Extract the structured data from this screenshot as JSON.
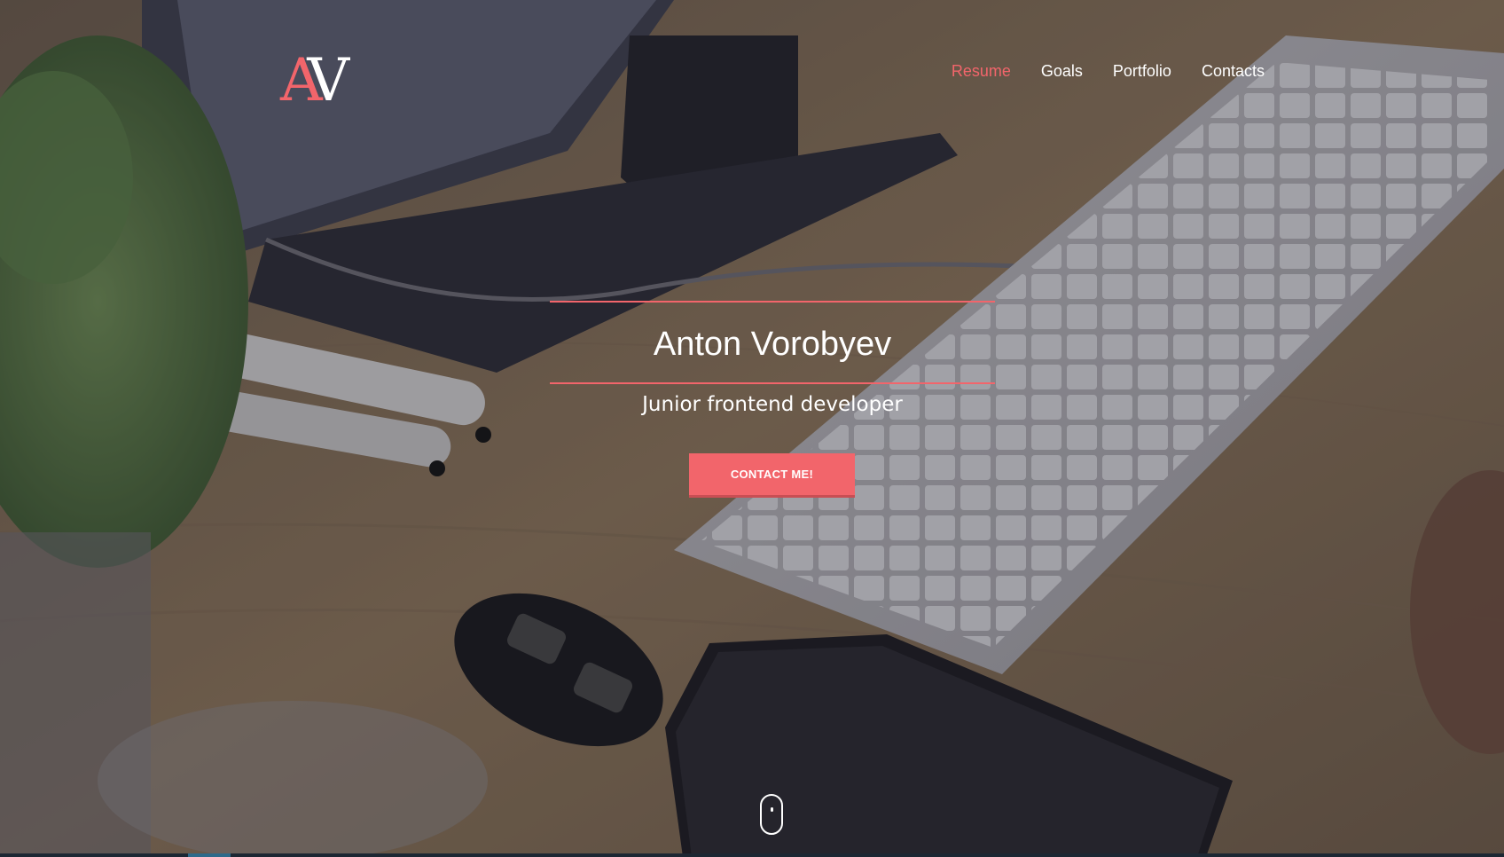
{
  "logo": {
    "letter_a": "A",
    "letter_v": "V"
  },
  "nav": {
    "items": [
      {
        "label": "Resume",
        "active": true
      },
      {
        "label": "Goals",
        "active": false
      },
      {
        "label": "Portfolio",
        "active": false
      },
      {
        "label": "Contacts",
        "active": false
      }
    ]
  },
  "hero": {
    "name": "Anton Vorobyev",
    "role": "Junior frontend developer",
    "cta_label": "CONTACT ME!"
  },
  "icons": {
    "scroll": "mouse-scroll-icon"
  },
  "colors": {
    "accent": "#f2656b",
    "text": "#ffffff",
    "overlay": "#1e1c28"
  }
}
